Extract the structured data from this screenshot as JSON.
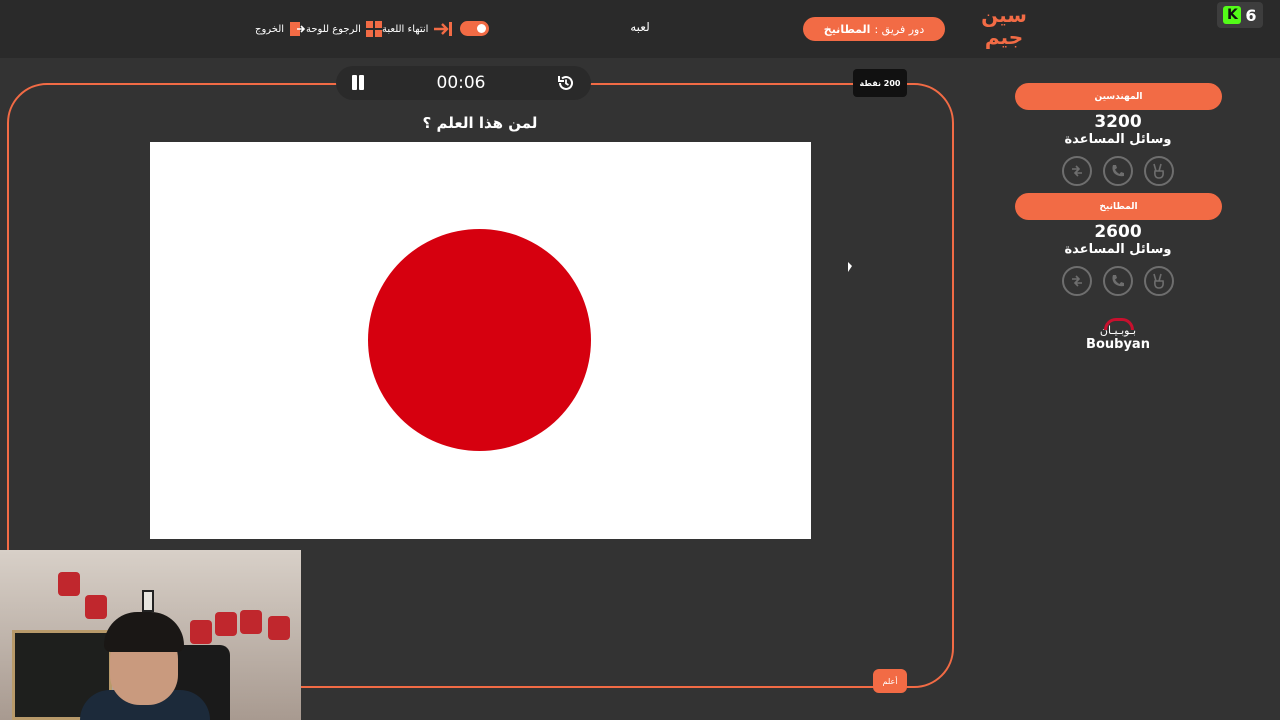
{
  "topbar": {
    "exit_label": "الخروج",
    "board_label": "الرجوع للوحة",
    "end_game_label": "انتهاء اللعبة",
    "game_name": "لعبه",
    "turn_prefix": "دور فريق :",
    "turn_team": "المطانيخ",
    "logo_line1": "سين",
    "logo_line2": "جيم",
    "badge_count": "6"
  },
  "question": {
    "timer": "00:06",
    "points": "200 نقطة",
    "text": "لمن هذا العلم ؟",
    "answer_button": "أعلم"
  },
  "teams": [
    {
      "name": "المهندسين",
      "score": "3200",
      "aids_label": "وسائل المساعدة"
    },
    {
      "name": "المطانيخ",
      "score": "2600",
      "aids_label": "وسائل المساعدة"
    }
  ],
  "aid_icons": [
    "swap-icon",
    "phone-icon",
    "two-fingers-icon"
  ],
  "sponsor": {
    "arabic": "بـوبـيـان",
    "english": "Boubyan"
  },
  "colors": {
    "accent": "#f26b45",
    "background": "#333333",
    "flag_red": "#d6000f"
  }
}
